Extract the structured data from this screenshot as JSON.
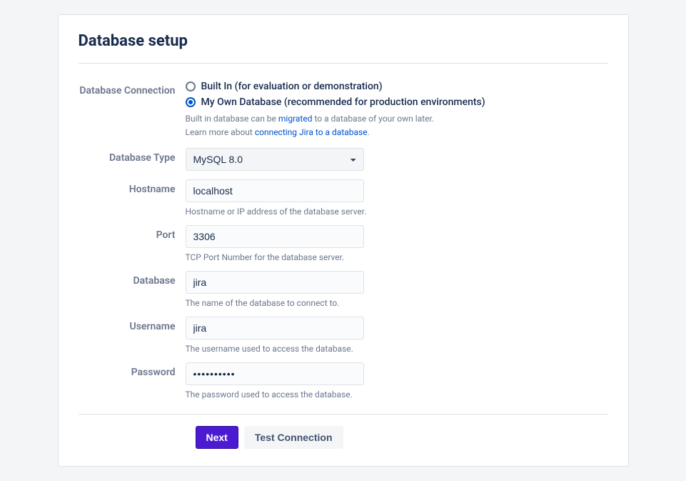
{
  "title": "Database setup",
  "connection": {
    "label": "Database Connection",
    "options": {
      "builtin": "Built In (for evaluation or demonstration)",
      "own": "My Own Database (recommended for production environments)"
    },
    "helper1_pre": "Built in database can be ",
    "helper1_link": "migrated",
    "helper1_post": " to a database of your own later.",
    "helper2_pre": "Learn more about ",
    "helper2_link": "connecting Jira to a database",
    "helper2_post": "."
  },
  "fields": {
    "dbtype": {
      "label": "Database Type",
      "value": "MySQL 8.0"
    },
    "hostname": {
      "label": "Hostname",
      "value": "localhost",
      "helper": "Hostname or IP address of the database server."
    },
    "port": {
      "label": "Port",
      "value": "3306",
      "helper": "TCP Port Number for the database server."
    },
    "database": {
      "label": "Database",
      "value": "jira",
      "helper": "The name of the database to connect to."
    },
    "username": {
      "label": "Username",
      "value": "jira",
      "helper": "The username used to access the database."
    },
    "password": {
      "label": "Password",
      "value": "••••••••••",
      "helper": "The password used to access the database."
    }
  },
  "buttons": {
    "next": "Next",
    "test": "Test Connection"
  }
}
